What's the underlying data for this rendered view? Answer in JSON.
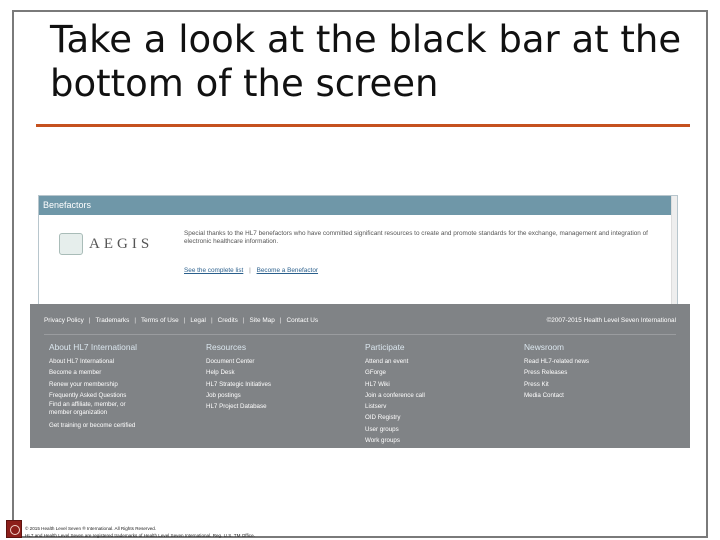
{
  "slide": {
    "title": "Take a look at the black bar at the bottom of the screen",
    "accent_color": "#c5511f"
  },
  "benefactors": {
    "header": "Benefactors",
    "logo_text": "AEGIS",
    "body": "Special thanks to the HL7 benefactors who have committed significant resources to create and promote standards for the exchange, management and integration of electronic healthcare information.",
    "link_complete_list": "See the complete list",
    "link_separator": "|",
    "link_become": "Become a Benefactor",
    "header_color": "#6f97a8"
  },
  "footer": {
    "top_links": [
      "Privacy Policy",
      "Trademarks",
      "Terms of Use",
      "Legal",
      "Credits",
      "Site Map",
      "Contact Us"
    ],
    "copyright": "©2007-2015 Health Level Seven International",
    "columns": [
      {
        "heading": "About HL7 International",
        "items": [
          "About HL7 International",
          "Become a member",
          "Renew your membership",
          "Frequently Asked Questions",
          "Find an affiliate, member, or member organization",
          "Get training or become certified"
        ]
      },
      {
        "heading": "Resources",
        "items": [
          "Document Center",
          "Help Desk",
          "HL7 Strategic Initiatives",
          "Job postings",
          "HL7 Project Database"
        ]
      },
      {
        "heading": "Participate",
        "items": [
          "Attend an event",
          "GForge",
          "HL7 Wiki",
          "Join a conference call",
          "Listserv",
          "OID Registry",
          "User groups",
          "Work groups"
        ]
      },
      {
        "heading": "Newsroom",
        "items": [
          "Read HL7-related news",
          "Press Releases",
          "Press Kit",
          "Media Contact"
        ]
      }
    ],
    "background_color": "#808386"
  },
  "slide_footer": {
    "line1": "© 2015 Health Level Seven ® International. All Rights Reserved.",
    "line2": "HL7 and Health Level Seven are registered trademarks of Health Level Seven International. Reg. U.S. TM Office."
  }
}
